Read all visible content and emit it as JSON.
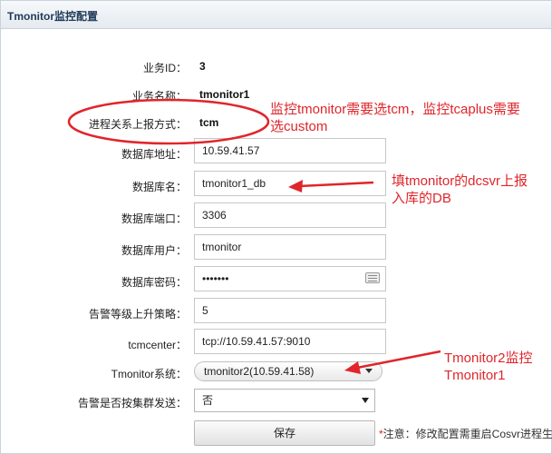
{
  "panel": {
    "title": "Tmonitor监控配置"
  },
  "fields": {
    "business_id": {
      "label": "业务ID：",
      "value": "3"
    },
    "business_name": {
      "label": "业务名称：",
      "value": "tmonitor1"
    },
    "report_method": {
      "label": "进程关系上报方式：",
      "value": "tcm"
    },
    "db_address": {
      "label": "数据库地址：",
      "value": "10.59.41.57"
    },
    "db_name": {
      "label": "数据库名：",
      "value": "tmonitor1_db"
    },
    "db_port": {
      "label": "数据库端口：",
      "value": "3306"
    },
    "db_user": {
      "label": "数据库用户：",
      "value": "tmonitor"
    },
    "db_password": {
      "label": "数据库密码：",
      "value": "•••••••"
    },
    "alarm_strategy": {
      "label": "告警等级上升策略：",
      "value": "5"
    },
    "tcmcenter": {
      "label": "tcmcenter：",
      "value": "tcp://10.59.41.57:9010"
    },
    "tmonitor_system": {
      "label": "Tmonitor系统：",
      "value": "tmonitor2(10.59.41.58)"
    },
    "cluster_send": {
      "label": "告警是否按集群发送：",
      "value": "否"
    }
  },
  "actions": {
    "save_label": "保存",
    "note_star": "*",
    "note_text": "注意：修改配置需重启Cosvr进程生"
  },
  "annotations": {
    "tcm_note_line1": "监控tmonitor需要选tcm，监控tcaplus需要",
    "tcm_note_line2": "选custom",
    "db_note_line1": "填tmonitor的dcsvr上报",
    "db_note_line2": "入库的DB",
    "sys_note_line1": "Tmonitor2监控",
    "sys_note_line2": "Tmonitor1"
  },
  "colors": {
    "annotation": "#e0252b",
    "header_text": "#1f3a57"
  }
}
